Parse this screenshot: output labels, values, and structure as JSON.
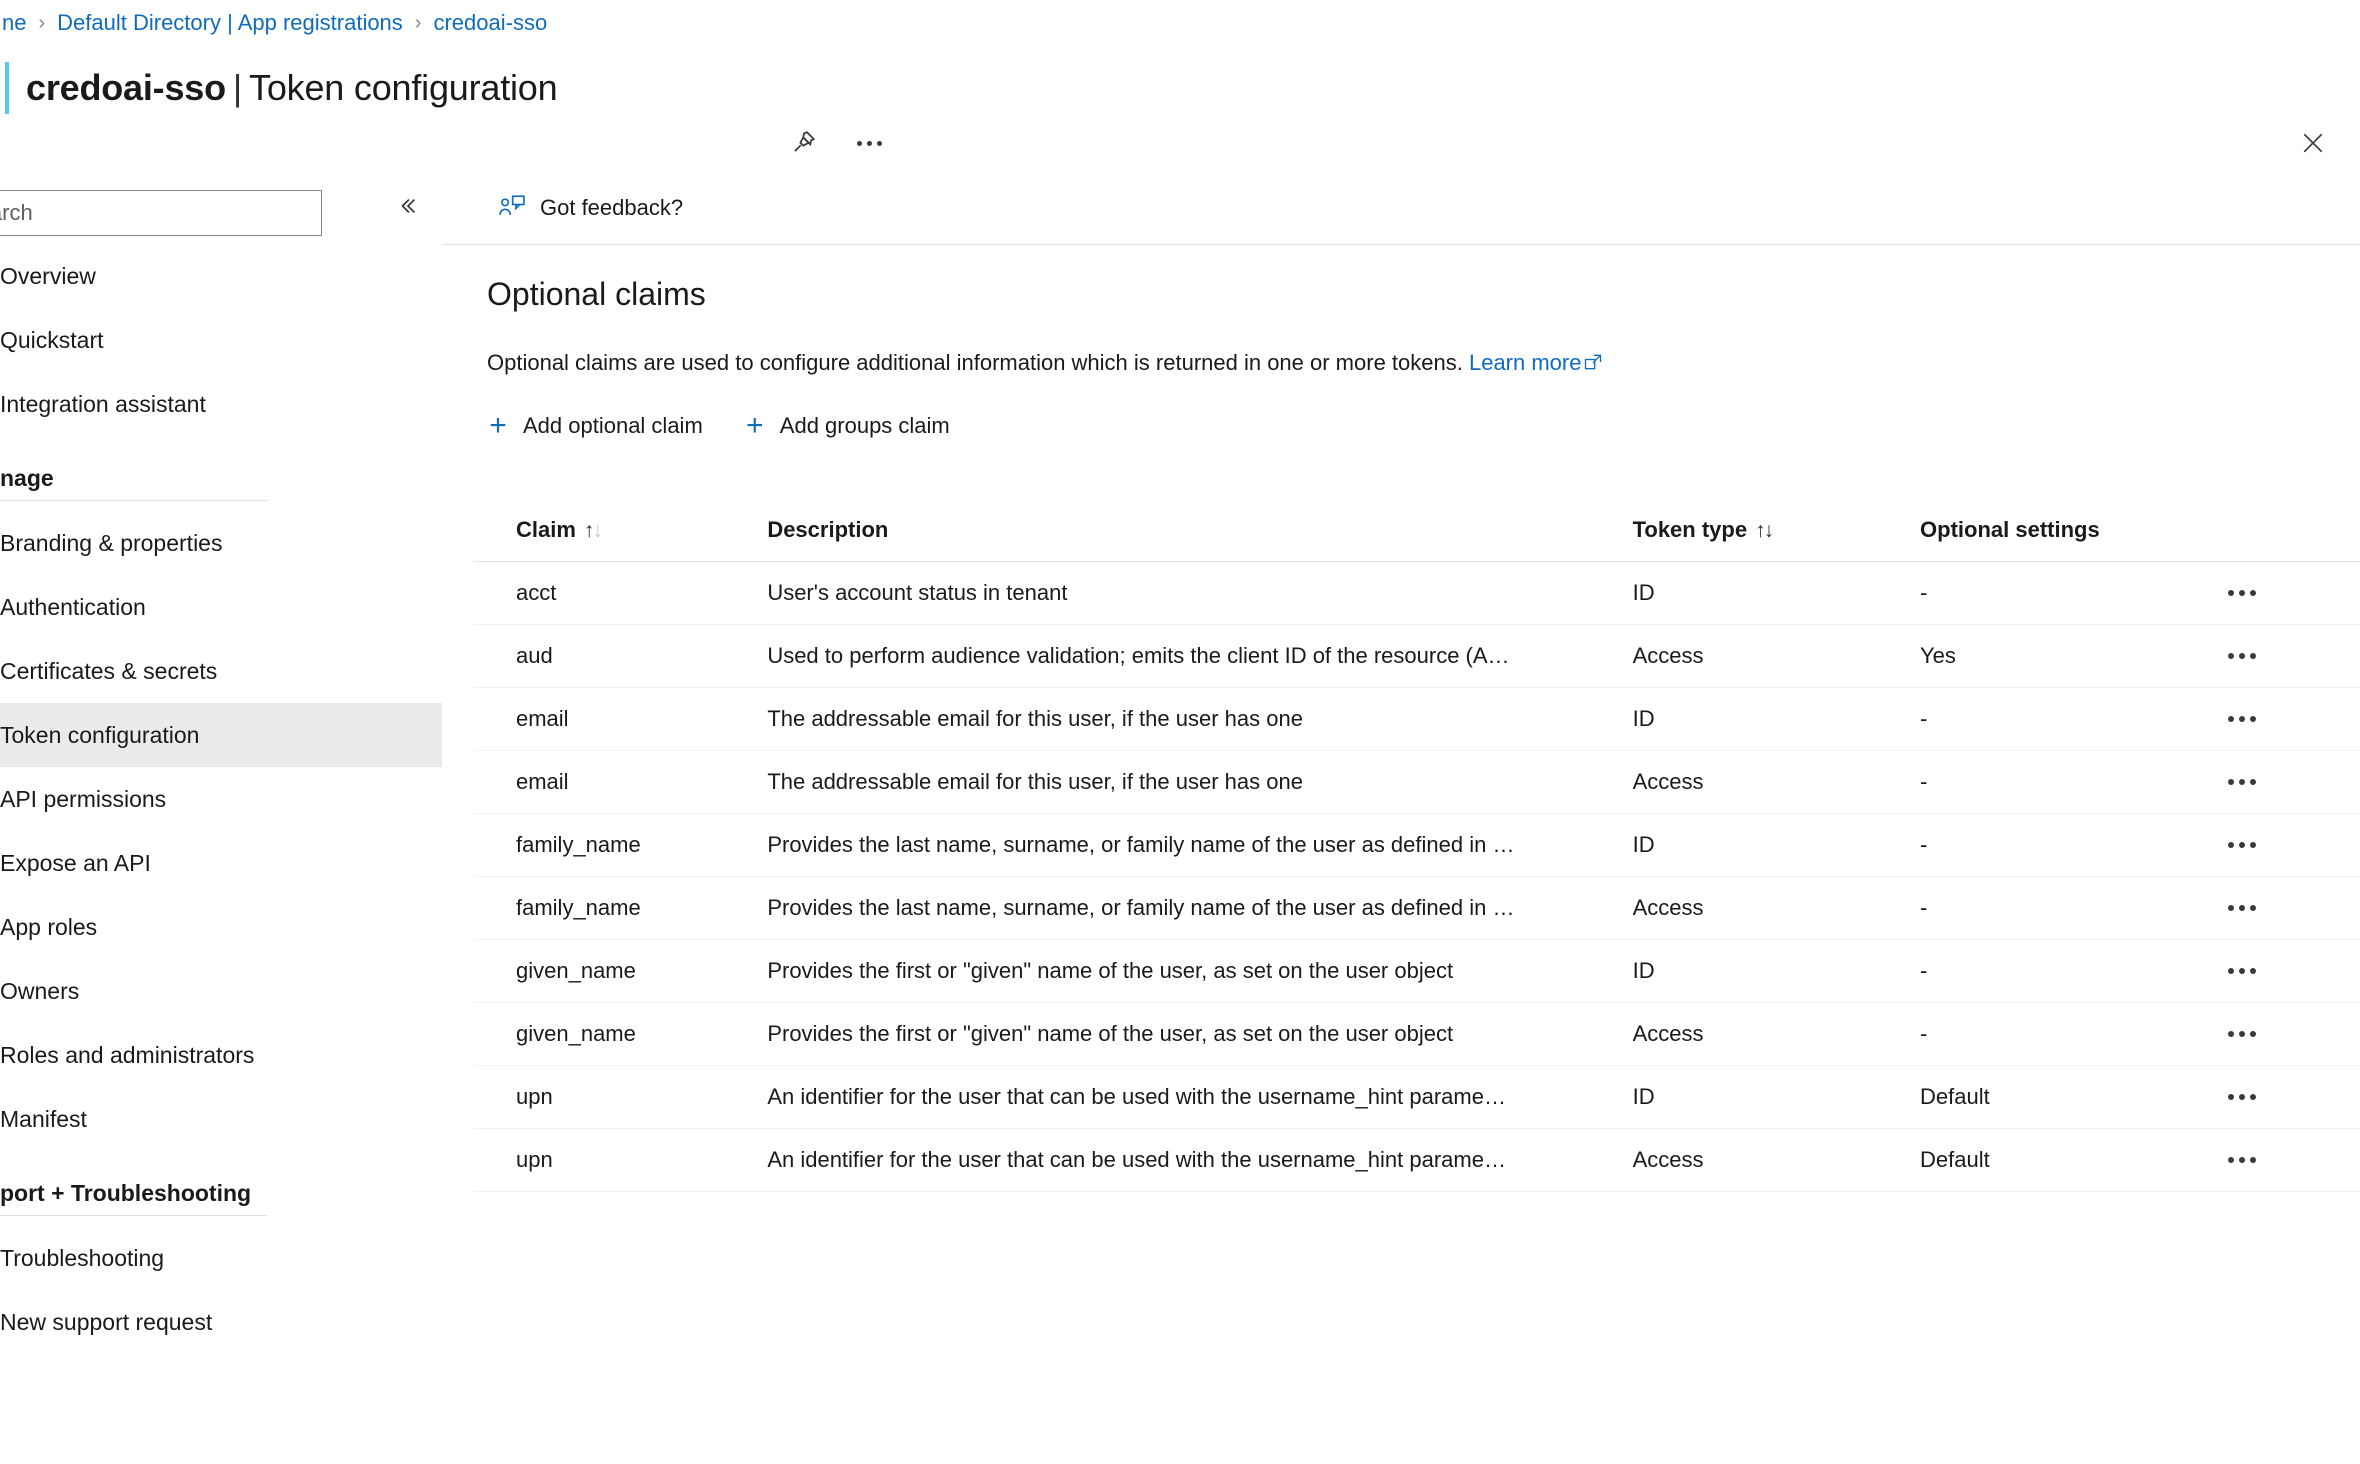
{
  "breadcrumb": {
    "items": [
      {
        "label": "ne",
        "name": "breadcrumb-home"
      },
      {
        "label": "Default Directory | App registrations",
        "name": "breadcrumb-app-registrations"
      },
      {
        "label": "credoai-sso",
        "name": "breadcrumb-credoai-sso"
      }
    ],
    "separator": "›"
  },
  "title": {
    "app_name": "credoai-sso",
    "divider": "|",
    "page_name": "Token configuration",
    "pin_icon": "pin-icon",
    "more_icon": "ellipsis-icon",
    "close_icon": "close-icon"
  },
  "sidebar": {
    "search": {
      "placeholder": "Search",
      "value": ""
    },
    "collapse_label": "«",
    "items": [
      {
        "label": "Overview",
        "type": "link",
        "selected": false,
        "name": "sidebar-item-overview"
      },
      {
        "label": "Quickstart",
        "type": "link",
        "selected": false,
        "name": "sidebar-item-quickstart"
      },
      {
        "label": "Integration assistant",
        "type": "link",
        "selected": false,
        "name": "sidebar-item-integration-assistant"
      },
      {
        "label": "nage",
        "type": "group",
        "selected": false,
        "name": "sidebar-group-manage"
      },
      {
        "label": "Branding & properties",
        "type": "link",
        "selected": false,
        "name": "sidebar-item-branding-properties"
      },
      {
        "label": "Authentication",
        "type": "link",
        "selected": false,
        "name": "sidebar-item-authentication"
      },
      {
        "label": "Certificates & secrets",
        "type": "link",
        "selected": false,
        "name": "sidebar-item-certificates-secrets"
      },
      {
        "label": "Token configuration",
        "type": "link",
        "selected": true,
        "name": "sidebar-item-token-configuration"
      },
      {
        "label": "API permissions",
        "type": "link",
        "selected": false,
        "name": "sidebar-item-api-permissions"
      },
      {
        "label": "Expose an API",
        "type": "link",
        "selected": false,
        "name": "sidebar-item-expose-an-api"
      },
      {
        "label": "App roles",
        "type": "link",
        "selected": false,
        "name": "sidebar-item-app-roles"
      },
      {
        "label": "Owners",
        "type": "link",
        "selected": false,
        "name": "sidebar-item-owners"
      },
      {
        "label": "Roles and administrators",
        "type": "link",
        "selected": false,
        "name": "sidebar-item-roles-and-administrators"
      },
      {
        "label": "Manifest",
        "type": "link",
        "selected": false,
        "name": "sidebar-item-manifest"
      },
      {
        "label": "port + Troubleshooting",
        "type": "group",
        "selected": false,
        "name": "sidebar-group-support-troubleshooting"
      },
      {
        "label": "Troubleshooting",
        "type": "link",
        "selected": false,
        "name": "sidebar-item-troubleshooting"
      },
      {
        "label": "New support request",
        "type": "link",
        "selected": false,
        "name": "sidebar-item-new-support-request"
      }
    ]
  },
  "command_bar": {
    "feedback_label": "Got feedback?",
    "feedback_icon": "feedback-person-icon"
  },
  "content": {
    "heading": "Optional claims",
    "description_prefix": "Optional claims are used to configure additional information which is returned in one or more tokens. ",
    "learn_more_label": "Learn more",
    "learn_more_icon": "external-link-icon",
    "add_optional_claim_label": "Add optional claim",
    "add_groups_claim_label": "Add groups claim",
    "plus_icon": "plus-icon"
  },
  "table": {
    "columns": [
      {
        "label": "Claim",
        "sortable": true,
        "name": "column-header-claim"
      },
      {
        "label": "Description",
        "sortable": false,
        "name": "column-header-description"
      },
      {
        "label": "Token type",
        "sortable": true,
        "name": "column-header-token-type"
      },
      {
        "label": "Optional settings",
        "sortable": false,
        "name": "column-header-optional-settings"
      },
      {
        "label": "",
        "sortable": false,
        "name": "column-header-actions"
      }
    ],
    "sort_icon_up": "↑",
    "sort_icon_down": "↓",
    "row_menu_icon": "ellipsis-icon",
    "rows": [
      {
        "claim": "acct",
        "description": "User's account status in tenant",
        "token_type": "ID",
        "optional_settings": "-"
      },
      {
        "claim": "aud",
        "description": "Used to perform audience validation; emits the client ID of the resource (A…",
        "token_type": "Access",
        "optional_settings": "Yes"
      },
      {
        "claim": "email",
        "description": "The addressable email for this user, if the user has one",
        "token_type": "ID",
        "optional_settings": "-"
      },
      {
        "claim": "email",
        "description": "The addressable email for this user, if the user has one",
        "token_type": "Access",
        "optional_settings": "-"
      },
      {
        "claim": "family_name",
        "description": "Provides the last name, surname, or family name of the user as defined in …",
        "token_type": "ID",
        "optional_settings": "-"
      },
      {
        "claim": "family_name",
        "description": "Provides the last name, surname, or family name of the user as defined in …",
        "token_type": "Access",
        "optional_settings": "-"
      },
      {
        "claim": "given_name",
        "description": "Provides the first or \"given\" name of the user, as set on the user object",
        "token_type": "ID",
        "optional_settings": "-"
      },
      {
        "claim": "given_name",
        "description": "Provides the first or \"given\" name of the user, as set on the user object",
        "token_type": "Access",
        "optional_settings": "-"
      },
      {
        "claim": "upn",
        "description": "An identifier for the user that can be used with the username_hint parame…",
        "token_type": "ID",
        "optional_settings": "Default"
      },
      {
        "claim": "upn",
        "description": "An identifier for the user that can be used with the username_hint parame…",
        "token_type": "Access",
        "optional_settings": "Default"
      }
    ]
  },
  "colors": {
    "accent_blue": "#0f6cbd",
    "title_accent": "#50c9f5",
    "selected_bg": "#edebe9",
    "border": "#e1dfdd",
    "text": "#1b1a19"
  }
}
